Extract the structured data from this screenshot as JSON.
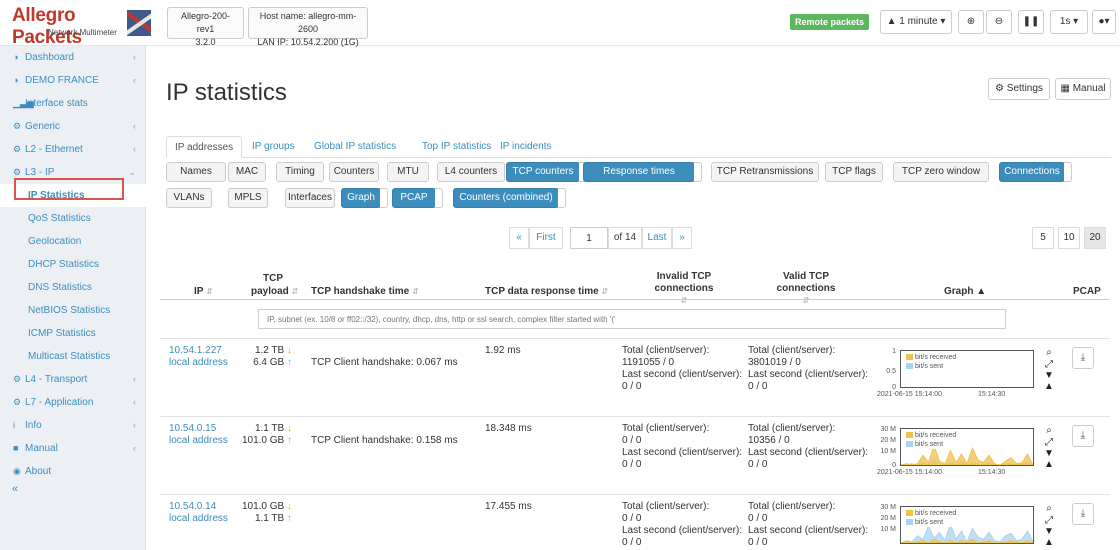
{
  "logo": {
    "title": "Allegro Packets",
    "subtitle": "Network Multimeter"
  },
  "device": {
    "name": "Allegro-200-rev1",
    "version": "3.2.0",
    "host": "Host name: allegro-mm-2600",
    "lan": "LAN IP: 10.54.2.200 (1G)"
  },
  "topbar": {
    "remote": "Remote packets",
    "interval": "1 minute",
    "refresh": "1s"
  },
  "sidebar": {
    "items": [
      {
        "label": "Dashboard",
        "icon": "dashboard-icon",
        "glyph": "◑",
        "chev": "‹"
      },
      {
        "label": "DEMO FRANCE",
        "icon": "dashboard-icon",
        "glyph": "◑",
        "chev": "‹"
      },
      {
        "label": "Interface stats",
        "icon": "bar-chart-icon",
        "glyph": "▁▃▅",
        "chev": ""
      },
      {
        "label": "Generic",
        "icon": "gear-icon",
        "glyph": "⚙",
        "chev": "‹"
      },
      {
        "label": "L2 - Ethernet",
        "icon": "gear-icon",
        "glyph": "⚙",
        "chev": "‹"
      },
      {
        "label": "L3 - IP",
        "icon": "gear-icon",
        "glyph": "⚙",
        "chev": "⌄"
      },
      {
        "label": "IP Statistics",
        "icon": "",
        "glyph": "",
        "chev": ""
      },
      {
        "label": "QoS Statistics",
        "icon": "",
        "glyph": "",
        "chev": ""
      },
      {
        "label": "Geolocation",
        "icon": "",
        "glyph": "",
        "chev": ""
      },
      {
        "label": "DHCP Statistics",
        "icon": "",
        "glyph": "",
        "chev": ""
      },
      {
        "label": "DNS Statistics",
        "icon": "",
        "glyph": "",
        "chev": ""
      },
      {
        "label": "NetBIOS Statistics",
        "icon": "",
        "glyph": "",
        "chev": ""
      },
      {
        "label": "ICMP Statistics",
        "icon": "",
        "glyph": "",
        "chev": ""
      },
      {
        "label": "Multicast Statistics",
        "icon": "",
        "glyph": "",
        "chev": ""
      },
      {
        "label": "L4 - Transport",
        "icon": "gear-icon",
        "glyph": "⚙",
        "chev": "‹"
      },
      {
        "label": "L7 - Application",
        "icon": "gear-icon",
        "glyph": "⚙",
        "chev": "‹"
      },
      {
        "label": "Info",
        "icon": "info-icon",
        "glyph": "i",
        "chev": "‹"
      },
      {
        "label": "Manual",
        "icon": "book-icon",
        "glyph": "■",
        "chev": "‹"
      },
      {
        "label": "About",
        "icon": "info-circle-icon",
        "glyph": "◉",
        "chev": ""
      }
    ],
    "collapse": "«"
  },
  "page": {
    "title": "IP statistics",
    "settings": "Settings",
    "manual": "Manual"
  },
  "tabs": [
    "IP addresses",
    "IP groups",
    "Global IP statistics",
    "Top IP statistics",
    "IP incidents"
  ],
  "subtabs_row1": [
    {
      "label": "Names",
      "on": false
    },
    {
      "label": "MAC",
      "on": false
    },
    {
      "label": "Timing",
      "on": false
    },
    {
      "label": "Counters",
      "on": false
    },
    {
      "label": "MTU",
      "on": false
    },
    {
      "label": "L4 counters",
      "on": false
    },
    {
      "label": "TCP counters",
      "on": true
    },
    {
      "label": "Response times",
      "on": true
    },
    {
      "label": "TCP Retransmissions",
      "on": false
    },
    {
      "label": "TCP flags",
      "on": false
    },
    {
      "label": "TCP zero window",
      "on": false
    },
    {
      "label": "Connections",
      "on": true
    }
  ],
  "subtabs_row2": [
    {
      "label": "VLANs",
      "on": false
    },
    {
      "label": "MPLS",
      "on": false
    },
    {
      "label": "Interfaces",
      "on": false
    },
    {
      "label": "Graph",
      "on": true
    },
    {
      "label": "PCAP",
      "on": true
    },
    {
      "label": "Counters (combined)",
      "on": true
    }
  ],
  "pager": {
    "prev": "«",
    "first": "First",
    "page": "1",
    "of": "of 14",
    "last": "Last",
    "next": "»",
    "sizes": [
      "5",
      "10",
      "20"
    ],
    "active_size": "20"
  },
  "table": {
    "headers": {
      "ip": "IP",
      "payload_1": "TCP",
      "payload_2": "payload",
      "handshake": "TCP handshake time",
      "response": "TCP data response time",
      "invalid": "Invalid TCP connections",
      "valid": "Valid TCP connections",
      "graph": "Graph",
      "pcap": "PCAP"
    },
    "filter_placeholder": "IP, subnet (ex. 10/8 or ff02::/32), country, dhcp, dns, http or ssl search, complex filter started with '('",
    "rows": [
      {
        "ip": "10.54.1.227",
        "sub": "local address",
        "rx": "1.2 TB",
        "tx": "6.4 GB",
        "handshake": "TCP Client handshake: 0.067 ms",
        "response": "1.92 ms",
        "inv_total_label": "Total (client/server):",
        "inv_total": "1191055 / 0",
        "inv_last_label": "Last second (client/server):",
        "inv_last": "0 / 0",
        "val_total_label": "Total (client/server):",
        "val_total": "3801019 / 0",
        "val_last_label": "Last second (client/server):",
        "val_last": "0 / 0",
        "graph": {
          "y_top": "1",
          "y_mid": "0.5",
          "y_zero": "0",
          "t1": "2021-06-15 15:14:00",
          "t2": "15:14:30",
          "legend_rx": "bit/s received",
          "legend_tx": "bit/s sent",
          "rx_values": [],
          "tx_values": []
        }
      },
      {
        "ip": "10.54.0.15",
        "sub": "local address",
        "rx": "1.1 TB",
        "tx": "101.0 GB",
        "handshake": "TCP Client handshake: 0.158 ms",
        "response": "18.348 ms",
        "inv_total_label": "Total (client/server):",
        "inv_total": "0 / 0",
        "inv_last_label": "Last second (client/server):",
        "inv_last": "0 / 0",
        "val_total_label": "Total (client/server):",
        "val_total": "10356 / 0",
        "val_last_label": "Last second (client/server):",
        "val_last": "0 / 0",
        "graph": {
          "y_top": "30 M",
          "y_mid": "20 M",
          "y_low": "10 M",
          "y_zero": "0",
          "t1": "2021-06-15 15:14:00",
          "t2": "15:14:30",
          "legend_rx": "bit/s received",
          "legend_tx": "bit/s sent",
          "rx_values": [
            0,
            1,
            0,
            1,
            8,
            2,
            16,
            3,
            1,
            12,
            2,
            9,
            1,
            14,
            4,
            2,
            8,
            1,
            0,
            3,
            6,
            1,
            2,
            9,
            0
          ],
          "tx_values": [
            0,
            0,
            1,
            0,
            2,
            0,
            4,
            1,
            0,
            2,
            0,
            3,
            0,
            2,
            1,
            0,
            2,
            0,
            0,
            1,
            1,
            0,
            1,
            2,
            0
          ]
        }
      },
      {
        "ip": "10.54.0.14",
        "sub": "local address",
        "rx": "101.0 GB",
        "tx": "1.1 TB",
        "handshake": "",
        "response": "17.455 ms",
        "inv_total_label": "Total (client/server):",
        "inv_total": "0 / 0",
        "inv_last_label": "Last second (client/server):",
        "inv_last": "0 / 0",
        "val_total_label": "Total (client/server):",
        "val_total": "0 / 0",
        "val_last_label": "Last second (client/server):",
        "val_last": "0 / 0",
        "graph": {
          "y_top": "30 M",
          "y_mid": "20 M",
          "y_low": "10 M",
          "y_zero": "",
          "t1": "",
          "t2": "",
          "legend_rx": "bit/s received",
          "legend_tx": "bit/s sent",
          "rx_values": [
            0,
            1,
            0,
            1,
            2,
            0,
            3,
            1,
            0,
            2,
            0,
            2,
            1,
            3,
            0,
            1,
            2,
            0,
            0,
            1,
            2,
            1,
            0,
            2,
            0
          ],
          "tx_values": [
            0,
            2,
            1,
            6,
            3,
            14,
            4,
            9,
            2,
            16,
            3,
            10,
            1,
            12,
            5,
            3,
            9,
            2,
            1,
            6,
            8,
            2,
            3,
            10,
            1
          ]
        }
      }
    ]
  },
  "colors": {
    "accent": "#3c8dbc",
    "rx": "#f0c14b",
    "tx": "#a9d3ee",
    "remote": "#5cb85c",
    "highlight": "#d9534f"
  }
}
